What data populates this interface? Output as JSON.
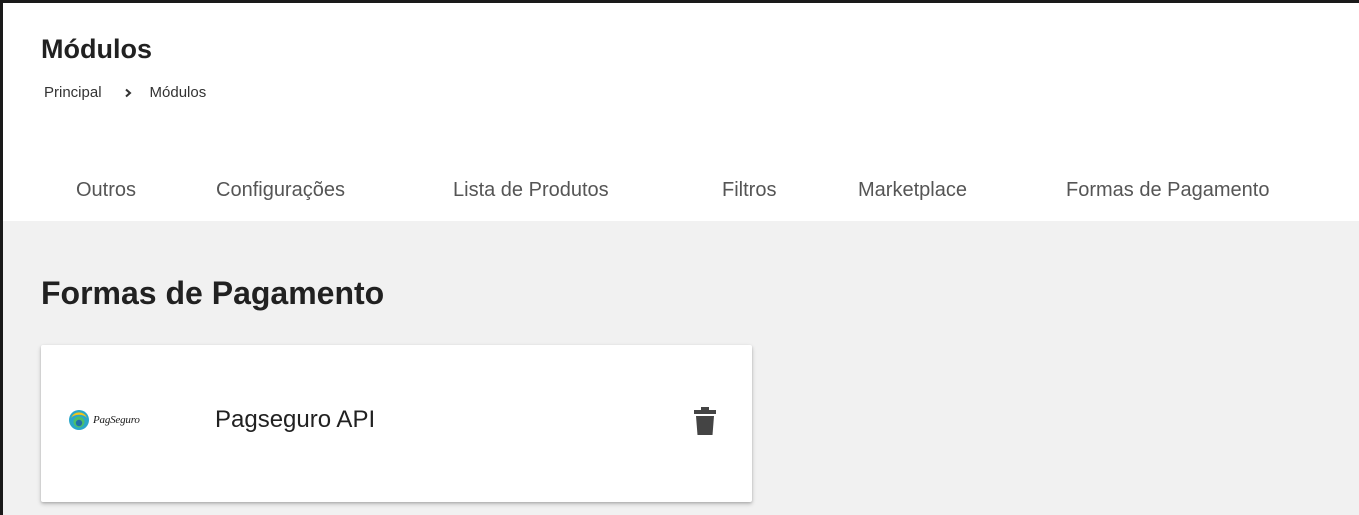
{
  "header": {
    "title": "Módulos",
    "breadcrumb": [
      {
        "label": "Principal"
      },
      {
        "label": "Módulos"
      }
    ],
    "breadcrumb_separator_icon": "chevron-right-icon"
  },
  "tabs": [
    {
      "label": "Outros"
    },
    {
      "label": "Configurações"
    },
    {
      "label": "Lista de Produtos"
    },
    {
      "label": "Filtros"
    },
    {
      "label": "Marketplace"
    },
    {
      "label": "Formas de Pagamento"
    }
  ],
  "main": {
    "section_title": "Formas de Pagamento",
    "modules": [
      {
        "logo_text": "PagSeguro",
        "name": "Pagseguro API",
        "action_icon": "trash-icon"
      }
    ]
  },
  "colors": {
    "content_background": "#f1f1f1",
    "card_background": "#ffffff",
    "tab_text": "#555555",
    "icon": "#444444"
  }
}
